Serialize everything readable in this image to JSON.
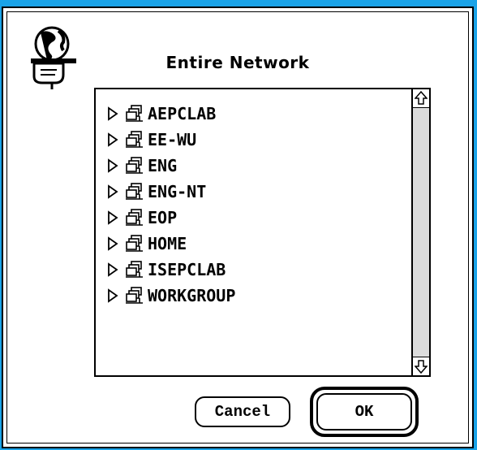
{
  "dialog": {
    "title": "Entire Network",
    "icon": "globe-hand-icon"
  },
  "network_list": {
    "items": [
      {
        "label": "AEPCLAB",
        "icon": "server-icon"
      },
      {
        "label": "EE-WU",
        "icon": "server-icon"
      },
      {
        "label": "ENG",
        "icon": "server-icon"
      },
      {
        "label": "ENG-NT",
        "icon": "server-icon"
      },
      {
        "label": "EOP",
        "icon": "server-icon"
      },
      {
        "label": "HOME",
        "icon": "server-icon"
      },
      {
        "label": "ISEPCLAB",
        "icon": "server-icon"
      },
      {
        "label": "WORKGROUP",
        "icon": "server-icon"
      }
    ]
  },
  "buttons": {
    "cancel_label": "Cancel",
    "ok_label": "OK"
  },
  "colors": {
    "desktop_background": "#1aa3e8",
    "dialog_background": "#ffffff",
    "scroll_track": "#dcdcdc"
  }
}
